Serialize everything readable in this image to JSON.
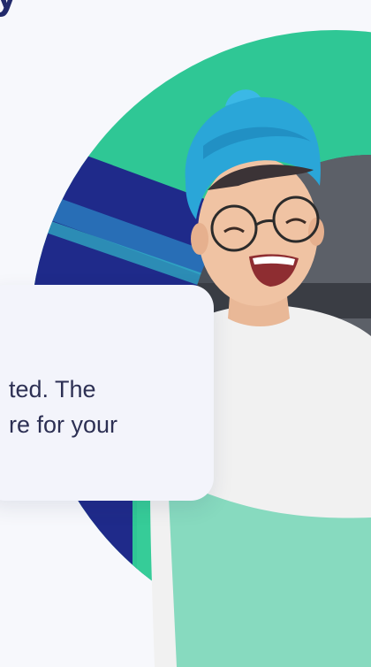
{
  "header": {
    "title_fragment": "y"
  },
  "hero": {
    "image_alt": "Smiling young person with blue hair wearing round glasses"
  },
  "card": {
    "line1": "ted. The",
    "line2": "re for your"
  },
  "colors": {
    "green": "#2fc795",
    "navy": "#1f2a8a",
    "background": "#f7f8fc",
    "card": "#f3f4fb",
    "text": "#2d3054"
  }
}
